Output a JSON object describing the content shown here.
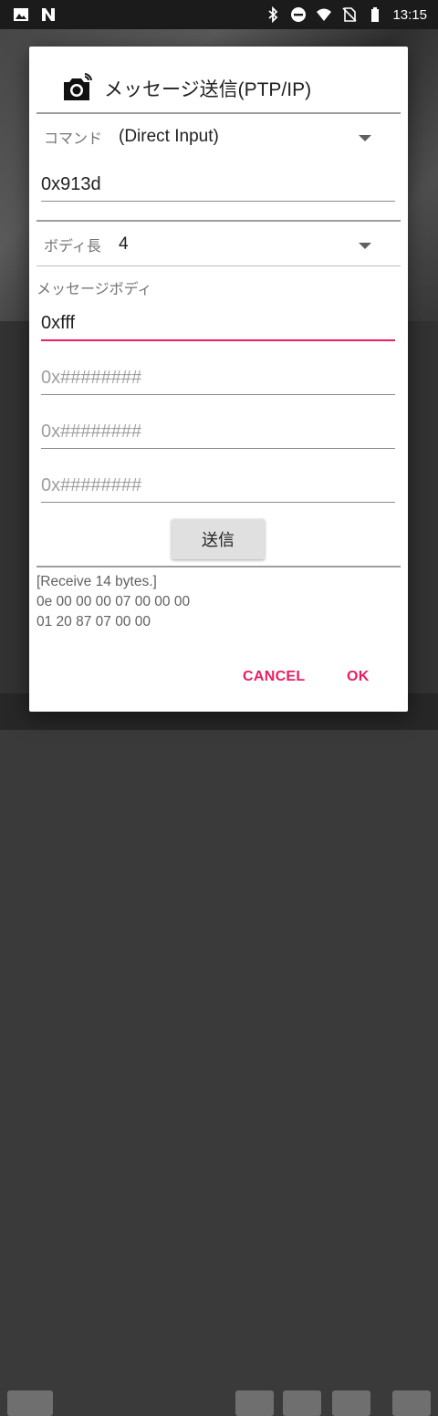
{
  "statusbar": {
    "time": "13:15",
    "icons_left": [
      "image-icon",
      "n-icon"
    ],
    "icons_right": [
      "bluetooth-icon",
      "dnd-icon",
      "wifi-icon",
      "no-sim-icon",
      "battery-icon"
    ]
  },
  "dialog": {
    "title": "メッセージ送信(PTP/IP)",
    "command": {
      "label": "コマンド",
      "selected": "(Direct Input)"
    },
    "command_value": "0x913d",
    "body_length": {
      "label": "ボディ長",
      "selected": "4"
    },
    "message_body_label": "メッセージボディ",
    "body_fields": [
      {
        "value": "0xfff",
        "placeholder": ""
      },
      {
        "value": "",
        "placeholder": "0x########"
      },
      {
        "value": "",
        "placeholder": "0x########"
      },
      {
        "value": "",
        "placeholder": "0x########"
      }
    ],
    "send_label": "送信",
    "receive_lines": [
      "[Receive 14 bytes.]",
      "0e 00 00 00 07 00 00 00",
      "01 20 87 07 00 00"
    ],
    "cancel_label": "CANCEL",
    "ok_label": "OK"
  },
  "colors": {
    "accent": "#e91e63",
    "divider": "#9e9e9e"
  }
}
